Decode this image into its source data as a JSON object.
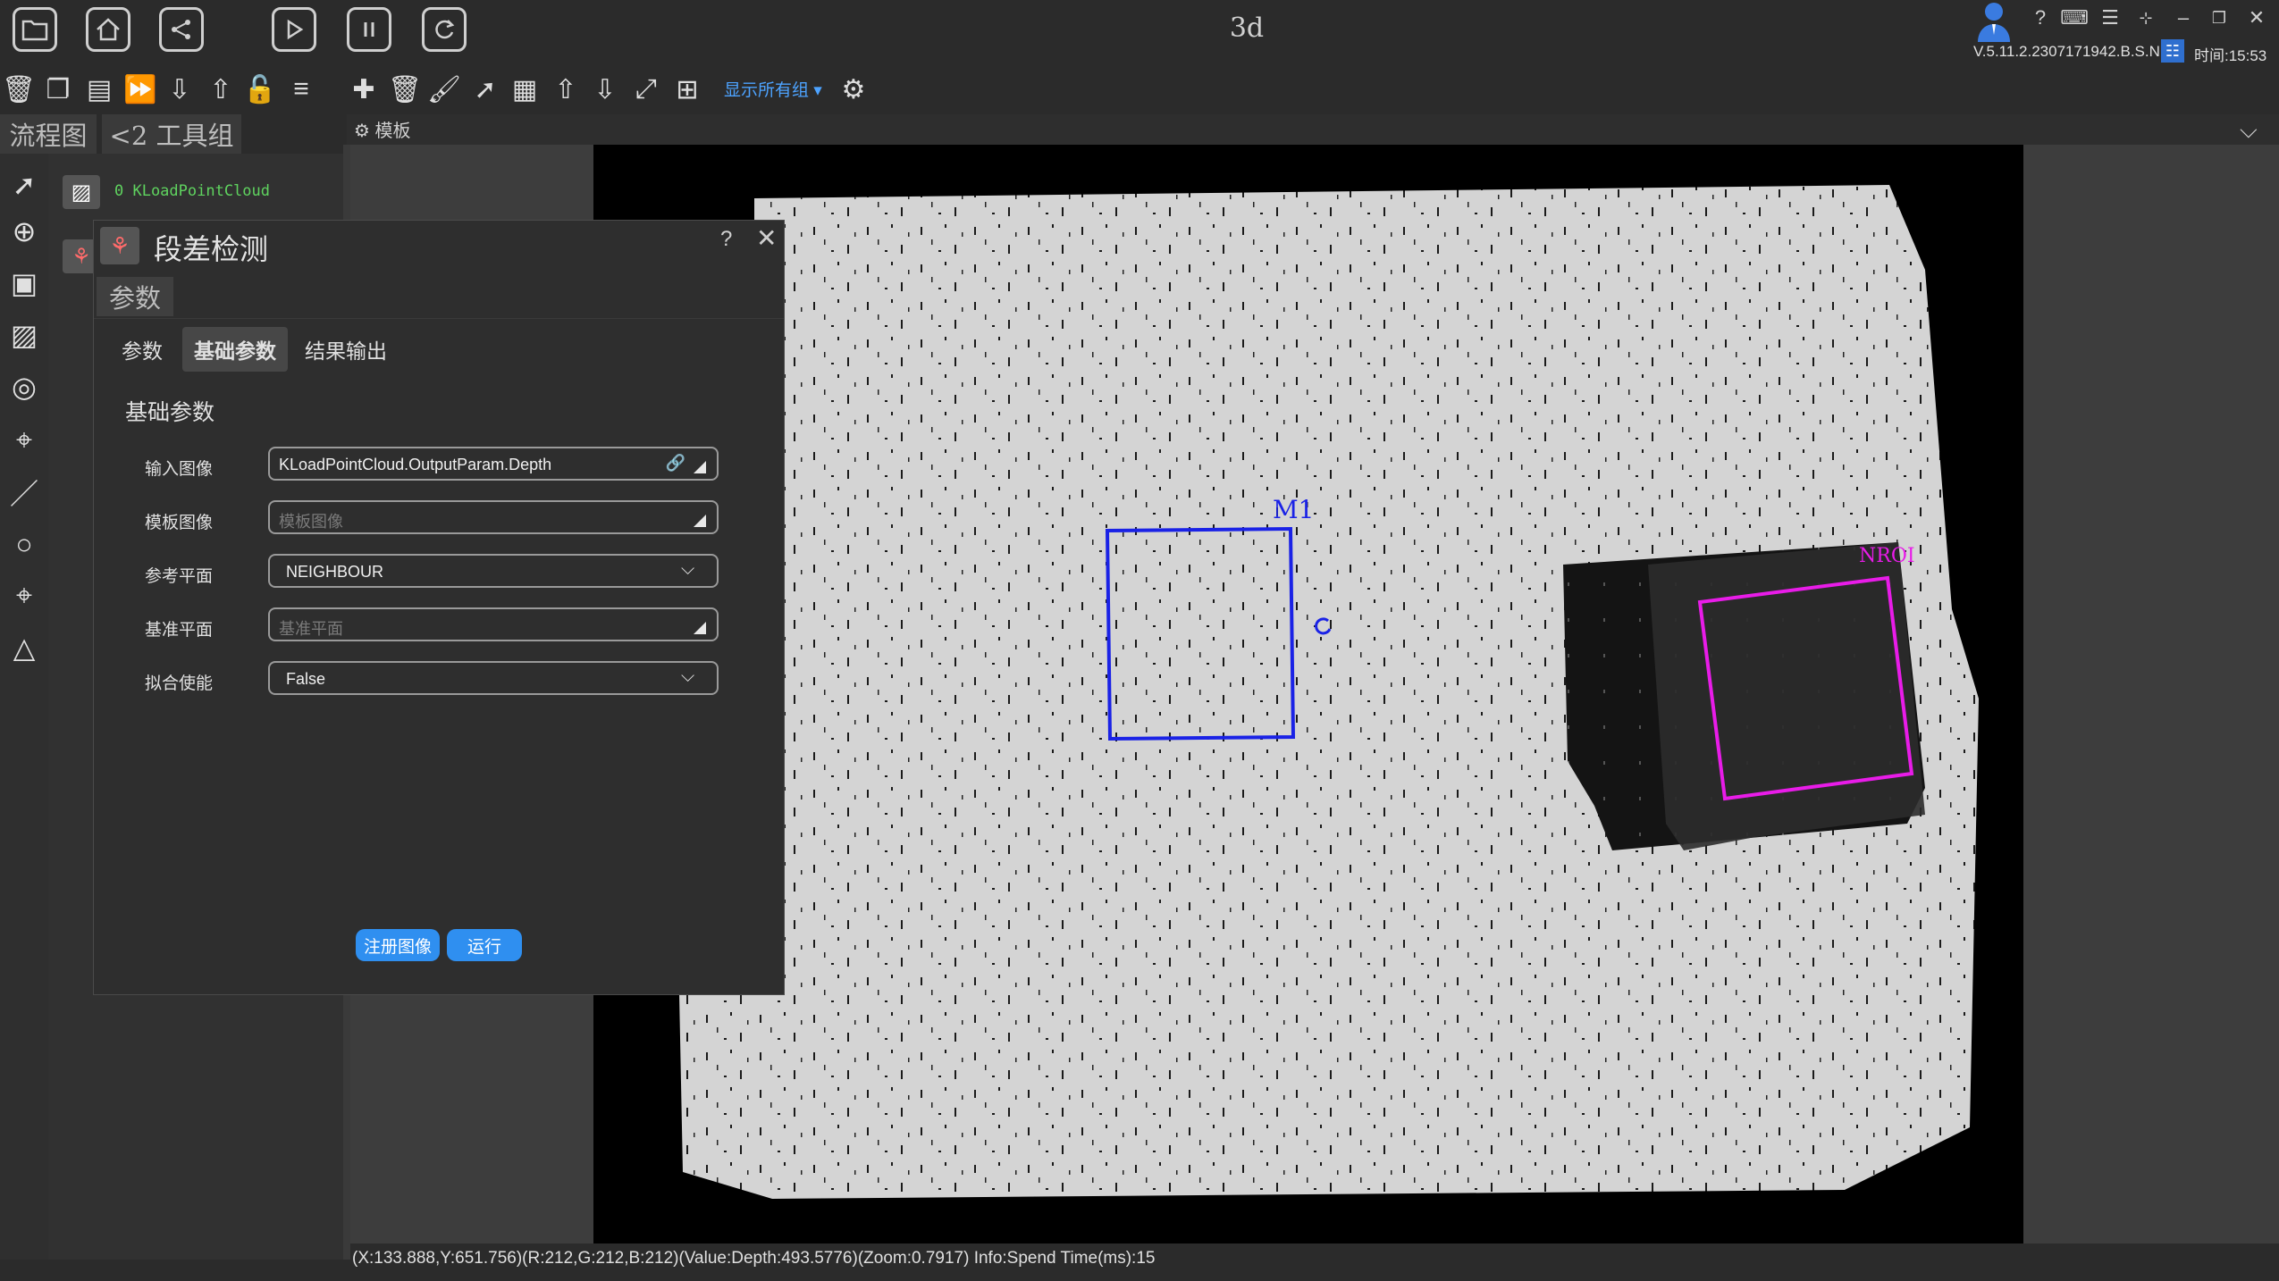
{
  "window": {
    "title": "3d",
    "version": "V.5.11.2.2307171942.B.S.N.",
    "time": "时间:15:53"
  },
  "toolbar": {
    "show_all_groups": "显示所有组"
  },
  "tabs": {
    "flow": "流程图",
    "group": "<2 工具组",
    "template": "模板"
  },
  "flow": {
    "nodes": [
      {
        "label": "0 KLoadPointCloud"
      }
    ]
  },
  "dialog": {
    "title": "段差检测",
    "help": "?",
    "close": "✕",
    "section_tab": "参数",
    "tabs": [
      "参数",
      "基础参数",
      "结果输出"
    ],
    "active_tab": "基础参数",
    "section_title": "基础参数",
    "fields": [
      {
        "label": "输入图像",
        "value": "KLoadPointCloud.OutputParam.Depth",
        "placeholder": ""
      },
      {
        "label": "模板图像",
        "value": "",
        "placeholder": "模板图像"
      },
      {
        "label": "参考平面",
        "value": "NEIGHBOUR",
        "placeholder": ""
      },
      {
        "label": "基准平面",
        "value": "",
        "placeholder": "基准平面"
      },
      {
        "label": "拟合使能",
        "value": "False",
        "placeholder": ""
      }
    ],
    "buttons": {
      "register": "注册图像",
      "run": "运行"
    }
  },
  "canvas": {
    "roi_blue_label": "M1",
    "roi_magenta_label": "NROI"
  },
  "colors": {
    "accent": "#2f8ff0",
    "roi_blue": "#1a22e6",
    "roi_magenta": "#e81ce8",
    "status_green": "#5fd35f"
  },
  "status": {
    "text": "(X:133.888,Y:651.756)(R:212,G:212,B:212)(Value:Depth:493.5776)(Zoom:0.7917)   Info:Spend Time(ms):15"
  }
}
